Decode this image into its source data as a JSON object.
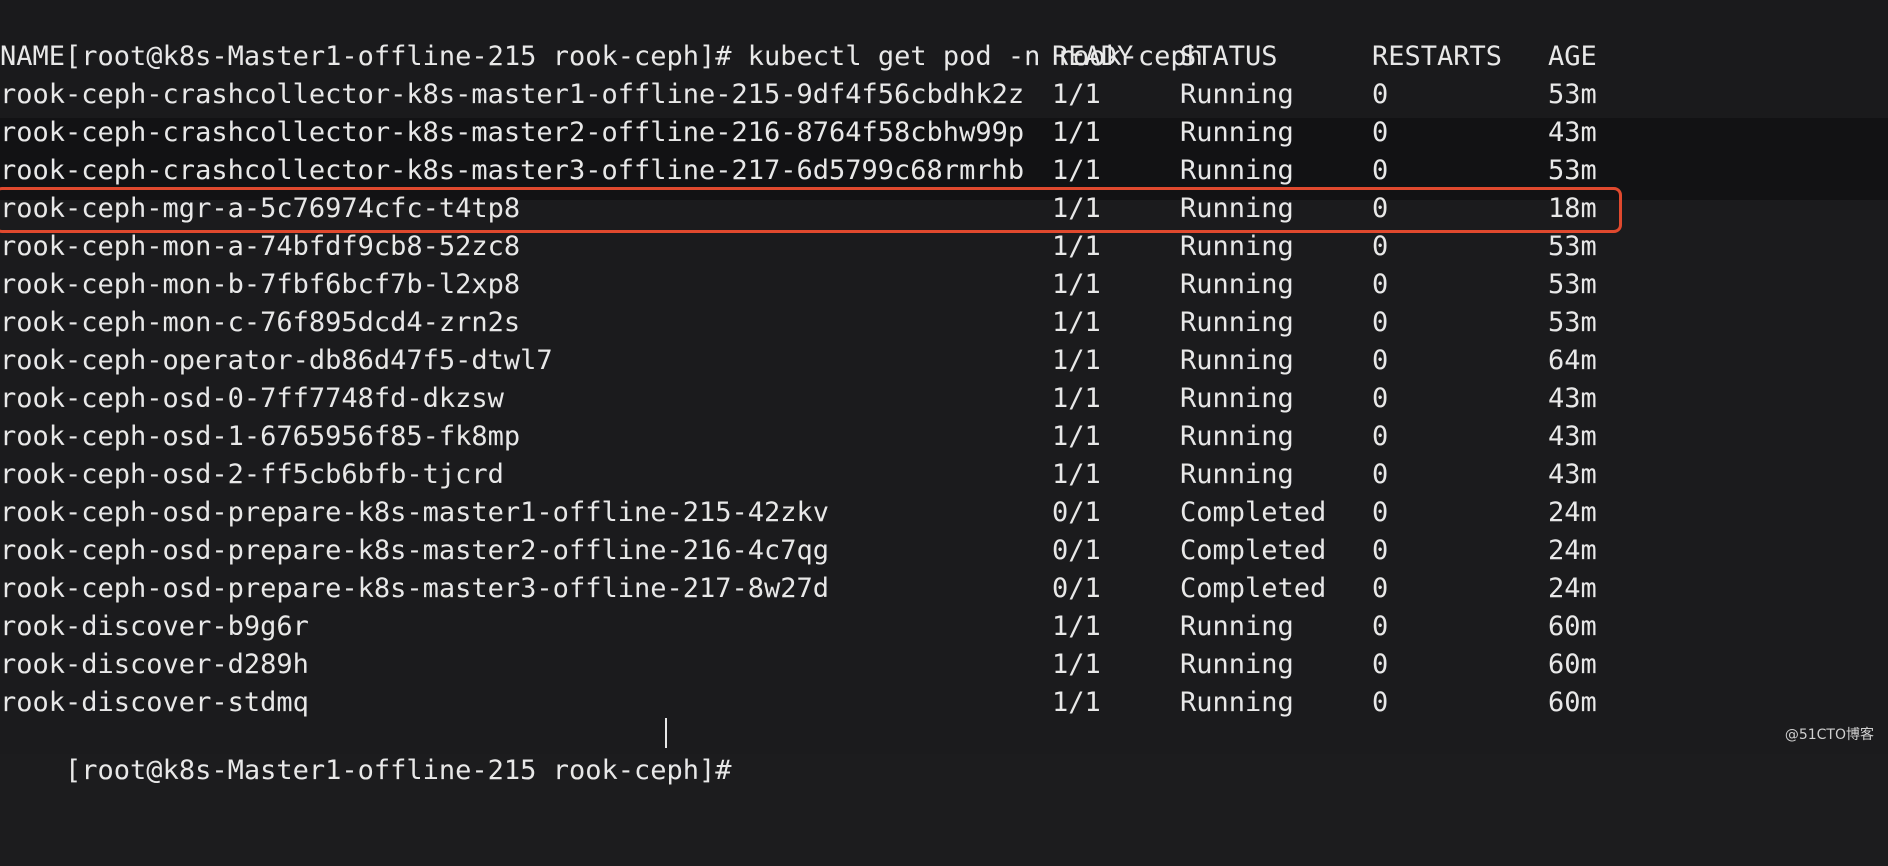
{
  "command_line": {
    "prompt": "[root@k8s-Master1-offline-215 rook-ceph]#",
    "command": "kubectl get pod -n rook-ceph"
  },
  "header": {
    "name": "NAME",
    "ready": "READY",
    "status": "STATUS",
    "restarts": "RESTARTS",
    "age": "AGE"
  },
  "pods": [
    {
      "name": "rook-ceph-crashcollector-k8s-master1-offline-215-9df4f56cbdhk2z",
      "ready": "1/1",
      "status": "Running",
      "restarts": "0",
      "age": "53m"
    },
    {
      "name": "rook-ceph-crashcollector-k8s-master2-offline-216-8764f58cbhw99p",
      "ready": "1/1",
      "status": "Running",
      "restarts": "0",
      "age": "43m"
    },
    {
      "name": "rook-ceph-crashcollector-k8s-master3-offline-217-6d5799c68rmrhb",
      "ready": "1/1",
      "status": "Running",
      "restarts": "0",
      "age": "53m"
    },
    {
      "name": "rook-ceph-mgr-a-5c76974cfc-t4tp8",
      "ready": "1/1",
      "status": "Running",
      "restarts": "0",
      "age": "18m"
    },
    {
      "name": "rook-ceph-mon-a-74bfdf9cb8-52zc8",
      "ready": "1/1",
      "status": "Running",
      "restarts": "0",
      "age": "53m"
    },
    {
      "name": "rook-ceph-mon-b-7fbf6bcf7b-l2xp8",
      "ready": "1/1",
      "status": "Running",
      "restarts": "0",
      "age": "53m"
    },
    {
      "name": "rook-ceph-mon-c-76f895dcd4-zrn2s",
      "ready": "1/1",
      "status": "Running",
      "restarts": "0",
      "age": "53m"
    },
    {
      "name": "rook-ceph-operator-db86d47f5-dtwl7",
      "ready": "1/1",
      "status": "Running",
      "restarts": "0",
      "age": "64m"
    },
    {
      "name": "rook-ceph-osd-0-7ff7748fd-dkzsw",
      "ready": "1/1",
      "status": "Running",
      "restarts": "0",
      "age": "43m"
    },
    {
      "name": "rook-ceph-osd-1-6765956f85-fk8mp",
      "ready": "1/1",
      "status": "Running",
      "restarts": "0",
      "age": "43m"
    },
    {
      "name": "rook-ceph-osd-2-ff5cb6bfb-tjcrd",
      "ready": "1/1",
      "status": "Running",
      "restarts": "0",
      "age": "43m"
    },
    {
      "name": "rook-ceph-osd-prepare-k8s-master1-offline-215-42zkv",
      "ready": "0/1",
      "status": "Completed",
      "restarts": "0",
      "age": "24m"
    },
    {
      "name": "rook-ceph-osd-prepare-k8s-master2-offline-216-4c7qg",
      "ready": "0/1",
      "status": "Completed",
      "restarts": "0",
      "age": "24m"
    },
    {
      "name": "rook-ceph-osd-prepare-k8s-master3-offline-217-8w27d",
      "ready": "0/1",
      "status": "Completed",
      "restarts": "0",
      "age": "24m"
    },
    {
      "name": "rook-discover-b9g6r",
      "ready": "1/1",
      "status": "Running",
      "restarts": "0",
      "age": "60m"
    },
    {
      "name": "rook-discover-d289h",
      "ready": "1/1",
      "status": "Running",
      "restarts": "0",
      "age": "60m"
    },
    {
      "name": "rook-discover-stdmq",
      "ready": "1/1",
      "status": "Running",
      "restarts": "0",
      "age": "60m"
    }
  ],
  "highlighted_pod": "rook-ceph-mgr-a-5c76974cfc-t4tp8",
  "highlight_color": "#e0492e",
  "final_prompt": "[root@k8s-Master1-offline-215 rook-ceph]#",
  "watermark": "@51CTO博客"
}
